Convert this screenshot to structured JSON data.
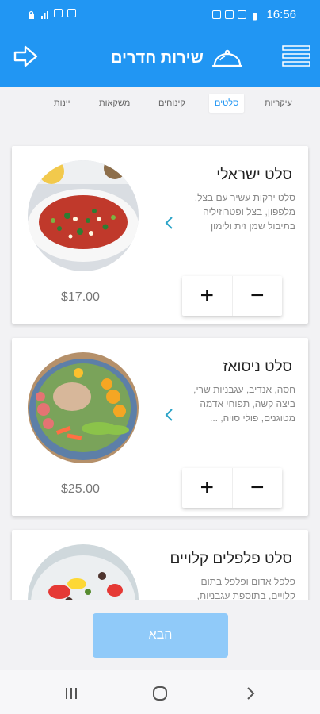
{
  "status_bar": {
    "time": "16:56"
  },
  "header": {
    "title": "שירות חדרים",
    "back_icon": "arrow-right-outline-icon",
    "menu_icon": "hamburger-menu-icon",
    "logo_icon": "serving-cloche-icon"
  },
  "tabs": [
    {
      "label": "עיקריות",
      "active": false
    },
    {
      "label": "סלטים",
      "active": true
    },
    {
      "label": "קינוחים",
      "active": false
    },
    {
      "label": "משקאות",
      "active": false
    },
    {
      "label": "יינות",
      "active": false
    }
  ],
  "items": [
    {
      "name": "סלט ישראלי",
      "description": "סלט ירקות עשיר עם בצל, מלפפון, בצל ופטרוזיליה בתיבול שמן זית ולימון",
      "price": "$17.00",
      "plus": "+",
      "minus": "−"
    },
    {
      "name": "סלט ניסואז",
      "description": "חסה, אנדיב, עגבניות שרי, ביצה קשה, תפוחי אדמה מטוגנים, פולי סויה, ...",
      "price": "$25.00",
      "plus": "+",
      "minus": "−"
    },
    {
      "name": "סלט פלפלים קלויים",
      "description": "פלפל אדום ופלפל בתום קלויים, בתוספת עגבניות,",
      "price": "",
      "plus": "+",
      "minus": "−"
    }
  ],
  "footer": {
    "next_label": "הבא"
  },
  "colors": {
    "primary": "#2196f3",
    "button_disabled": "#90caf9"
  }
}
